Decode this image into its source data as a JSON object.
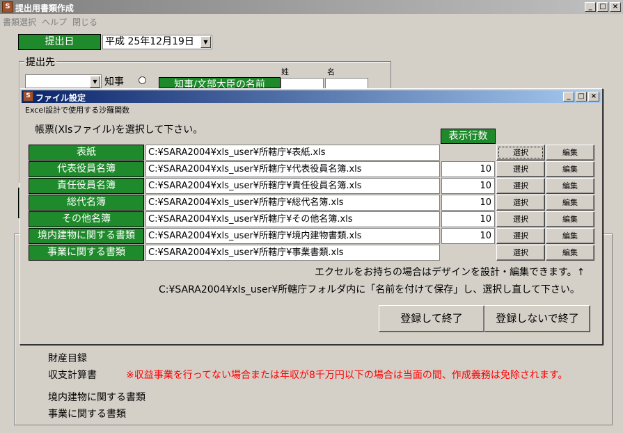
{
  "window": {
    "title": "提出用書類作成",
    "icon_label": "S"
  },
  "menu": [
    "書類選択",
    "ヘルプ",
    "閉じる"
  ],
  "submission_date": {
    "label": "提出日",
    "value": "平成 25年12月19日"
  },
  "destination": {
    "legend": "提出先",
    "governor_label": "知事",
    "name_button": "知事/文部大臣の名前",
    "surname_header": "姓",
    "given_name_header": "名"
  },
  "dialog": {
    "title": "ファイル設定",
    "subtitle": "Excel設計で使用する沙羅関数",
    "instruction": "帳票(Xlsファイル)を選択して下さい。",
    "rows_header": "表示行数",
    "select_label": "選択",
    "edit_label": "編集",
    "rows": [
      {
        "name": "表紙",
        "path": "C:¥SARA2004¥xls_user¥所轄庁¥表紙.xls",
        "count": ""
      },
      {
        "name": "代表役員名簿",
        "path": "C:¥SARA2004¥xls_user¥所轄庁¥代表役員名簿.xls",
        "count": "10"
      },
      {
        "name": "責任役員名簿",
        "path": "C:¥SARA2004¥xls_user¥所轄庁¥責任役員名簿.xls",
        "count": "10"
      },
      {
        "name": "総代名簿",
        "path": "C:¥SARA2004¥xls_user¥所轄庁¥総代名簿.xls",
        "count": "10"
      },
      {
        "name": "その他名簿",
        "path": "C:¥SARA2004¥xls_user¥所轄庁¥その他名簿.xls",
        "count": "10"
      },
      {
        "name": "境内建物に関する書類",
        "path": "C:¥SARA2004¥xls_user¥所轄庁¥境内建物書類.xls",
        "count": "10"
      },
      {
        "name": "事業に関する書類",
        "path": "C:¥SARA2004¥xls_user¥所轄庁¥事業書類.xls",
        "count": ""
      }
    ],
    "note1": "エクセルをお持ちの場合はデザインを設計・編集できます。↑",
    "note2": "C:¥SARA2004¥xls_user¥所轄庁フォルダ内に「名前を付けて保存」し、選択し直して下さい。",
    "register_button": "登録して終了",
    "no_register_button": "登録しないで終了"
  },
  "lower_list": {
    "items": [
      "財産目録",
      "収支計算書",
      "境内建物に関する書類",
      "事業に関する書類"
    ],
    "warning": "※収益事業を行ってない場合または年収が8千万円以下の場合は当面の間、作成義務は免除されます。"
  },
  "colors": {
    "label_green": "#1f8a2b",
    "dialog_title": "#0a246a",
    "warning_red": "#ff0000"
  }
}
